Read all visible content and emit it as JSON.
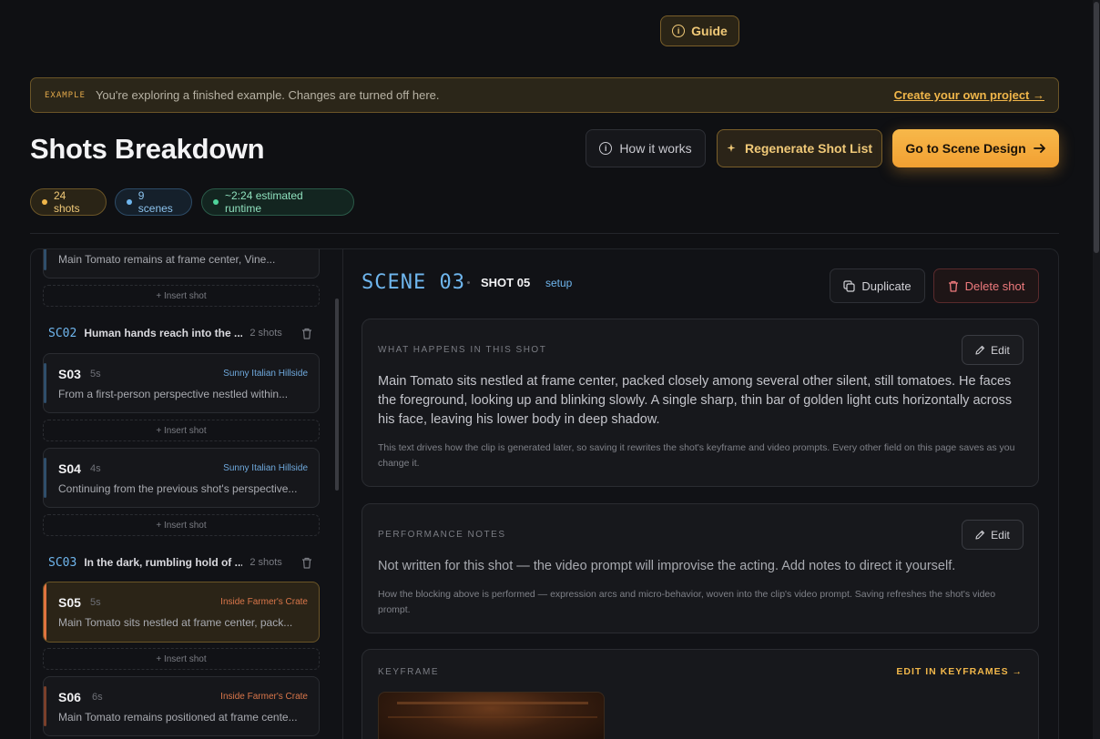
{
  "guide": {
    "label": "Guide",
    "icon": "info-icon"
  },
  "banner": {
    "tag": "EXAMPLE",
    "message": "You're exploring a finished example. Changes are turned off here.",
    "link": "Create your own project →"
  },
  "page": {
    "title": "Shots Breakdown"
  },
  "header_buttons": {
    "how": "How it works",
    "regenerate": "Regenerate Shot List",
    "scene_design": "Go to Scene Design"
  },
  "stats": {
    "shots": "24 shots",
    "scenes": "9 scenes",
    "runtime": "~2:24 estimated runtime"
  },
  "shot_list": {
    "insert_label": "+ Insert shot",
    "top_card_desc": "Main Tomato remains at frame center, Vine...",
    "scenes": [
      {
        "code": "SC02",
        "title": "Human hands reach into the ...",
        "count": "2 shots",
        "shots": [
          {
            "id": "S03",
            "duration": "5s",
            "location": "Sunny Italian Hillside",
            "desc": "From a first-person perspective nestled within..."
          },
          {
            "id": "S04",
            "duration": "4s",
            "location": "Sunny Italian Hillside",
            "desc": "Continuing from the previous shot's perspective..."
          }
        ]
      },
      {
        "code": "SC03",
        "title": "In the dark, rumbling hold of ...",
        "count": "2 shots",
        "shots": [
          {
            "id": "S05",
            "duration": "5s",
            "location": "Inside Farmer's Crate",
            "desc": "Main Tomato sits nestled at frame center, pack..."
          },
          {
            "id": "S06",
            "duration": "6s",
            "location": "Inside Farmer's Crate",
            "desc": "Main Tomato remains positioned at frame cente..."
          }
        ]
      }
    ]
  },
  "detail": {
    "scene_label": "SCENE 03",
    "shot_label": "SHOT 05",
    "shot_tag": "setup",
    "duplicate": "Duplicate",
    "delete": "Delete shot",
    "what_happens": {
      "label": "WHAT HAPPENS IN THIS SHOT",
      "edit": "Edit",
      "body": "Main Tomato sits nestled at frame center, packed closely among several other silent, still tomatoes. He faces the foreground, looking up and blinking slowly. A single sharp, thin bar of golden light cuts horizontally across his face, leaving his lower body in deep shadow.",
      "note": "This text drives how the clip is generated later, so saving it rewrites the shot's keyframe and video prompts. Every other field on this page saves as you change it."
    },
    "performance": {
      "label": "PERFORMANCE NOTES",
      "edit": "Edit",
      "body": "Not written for this shot — the video prompt will improvise the acting. Add notes to direct it yourself.",
      "note": "How the blocking above is performed — expression arcs and micro-behavior, woven into the clip's video prompt. Saving refreshes the shot's video prompt."
    },
    "keyframe": {
      "label": "KEYFRAME",
      "link": "EDIT IN KEYFRAMES →"
    }
  },
  "colors": {
    "accent": "#f2a032",
    "scene_blue": "#6fb6ee",
    "danger": "#ee7a7d"
  }
}
